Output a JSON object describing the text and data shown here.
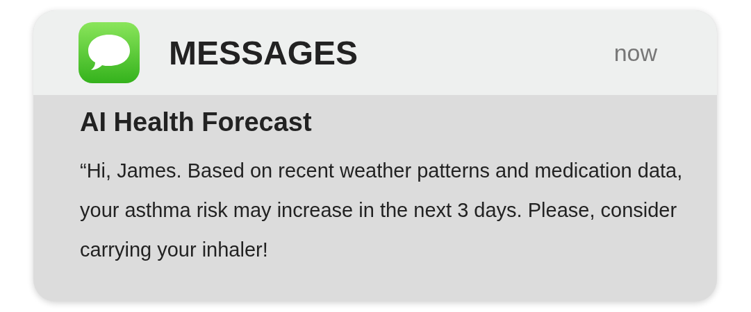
{
  "notification": {
    "app_name": "MESSAGES",
    "time": "now",
    "title": "AI Health Forecast",
    "body": "“Hi, James. Based on recent weather patterns and medication data, your asthma risk may increase in the next 3 days. Please, consider carrying your inhaler!"
  }
}
